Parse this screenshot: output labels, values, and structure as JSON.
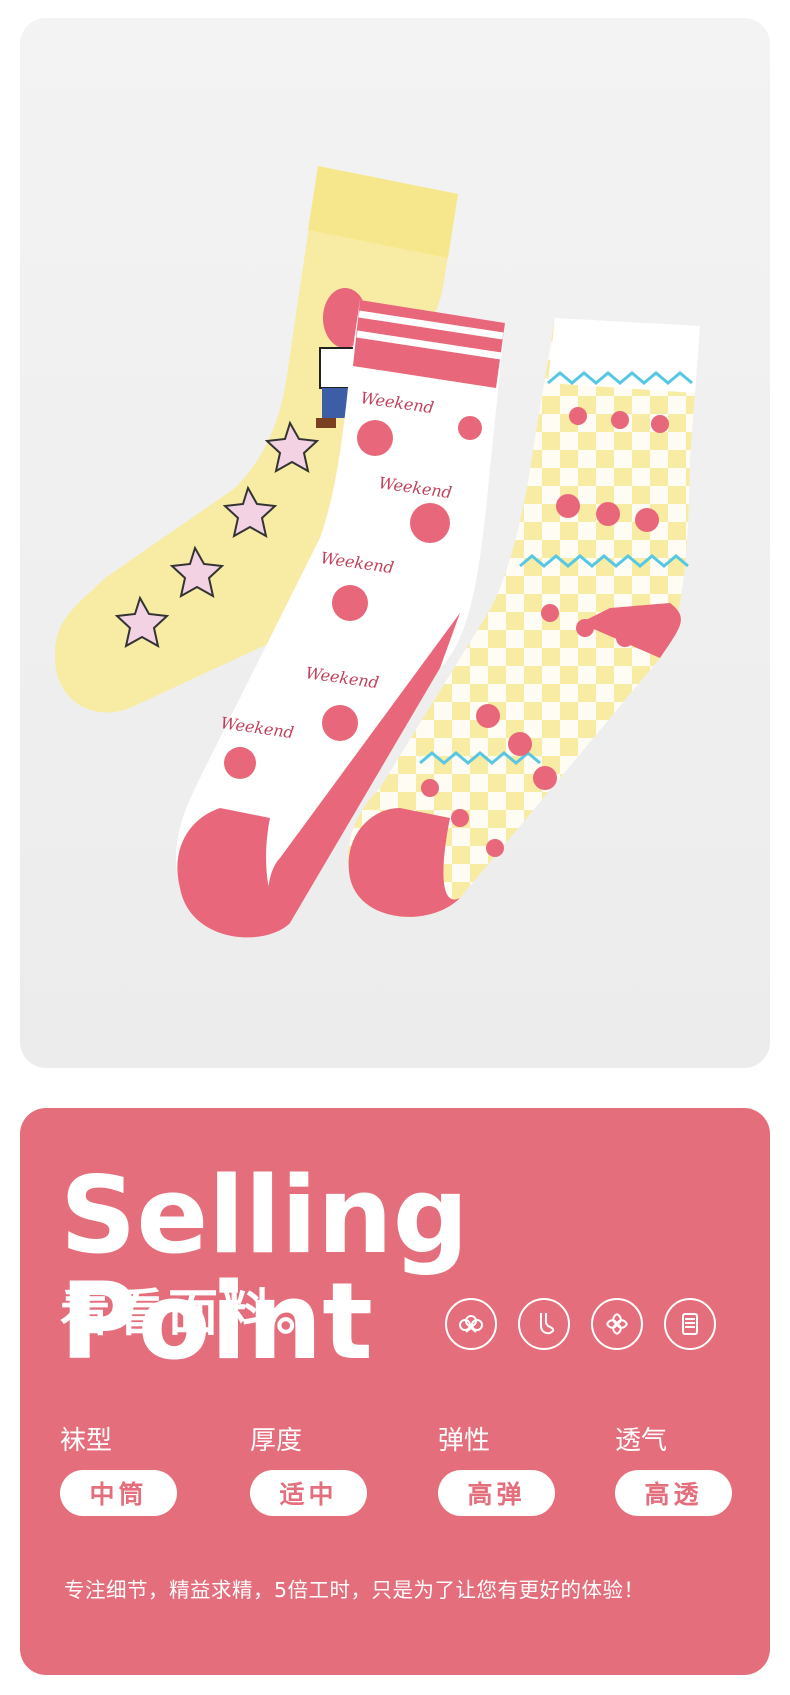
{
  "hero": {
    "alt": "three pairs of pink and yellow bunny crew socks"
  },
  "selling": {
    "headline": "Selling Point",
    "subhead": "看看面料。",
    "icons": [
      "cotton-icon",
      "foot-icon",
      "spin-icon",
      "yarn-spool-icon"
    ],
    "attributes": [
      {
        "label": "袜型",
        "value": "中筒"
      },
      {
        "label": "厚度",
        "value": "适中"
      },
      {
        "label": "弹性",
        "value": "高弹"
      },
      {
        "label": "透气",
        "value": "高透"
      }
    ],
    "tagline": "专注细节，精益求精，5倍工时，只是为了让您有更好的体验！"
  },
  "colors": {
    "card": "#e46e7b",
    "pink": "#e8677a",
    "yellow": "#f8eca4",
    "cyan": "#56c8e3"
  }
}
